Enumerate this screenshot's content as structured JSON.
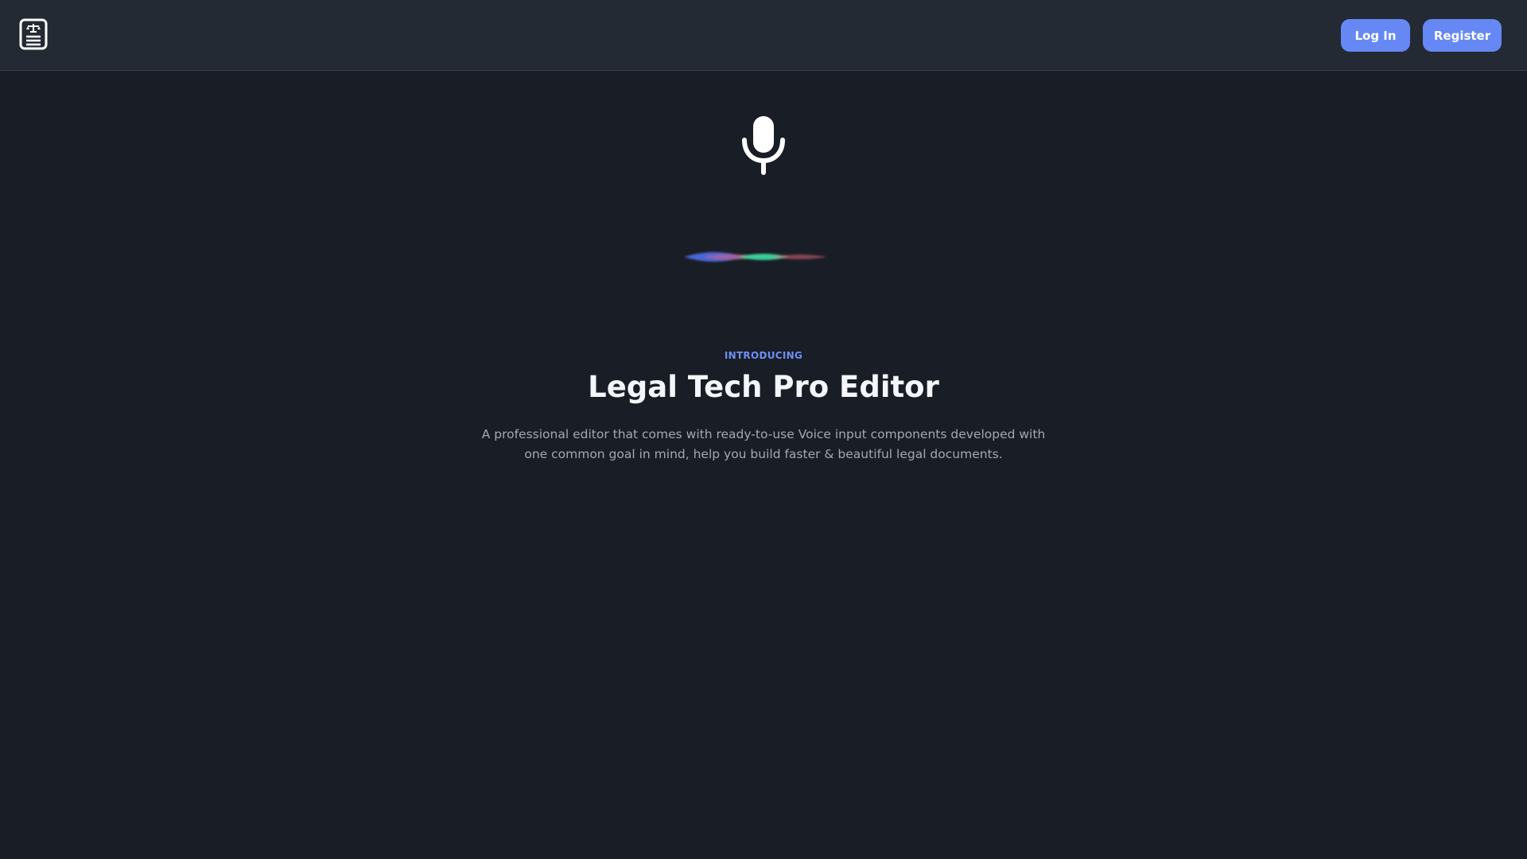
{
  "header": {
    "logo_icon": "legal-scales-document-icon",
    "login_label": "Log In",
    "register_label": "Register"
  },
  "hero": {
    "mic_icon": "microphone-icon",
    "wave_icon": "voice-waveform",
    "eyebrow": "INTRODUCING",
    "title": "Legal Tech Pro Editor",
    "description": "A professional editor that comes with ready-to-use Voice input components developed with one common goal in mind, help you build faster & beautiful legal documents."
  },
  "colors": {
    "background": "#191d25",
    "header_background": "#242a33",
    "accent": "#6688f5",
    "eyebrow": "#6f8ff7",
    "title": "#f4f6fa",
    "description": "#a2a9b5",
    "wave_blue": "#4f6fe8",
    "wave_pink": "#e0607a",
    "wave_green": "#3dd6a0"
  }
}
